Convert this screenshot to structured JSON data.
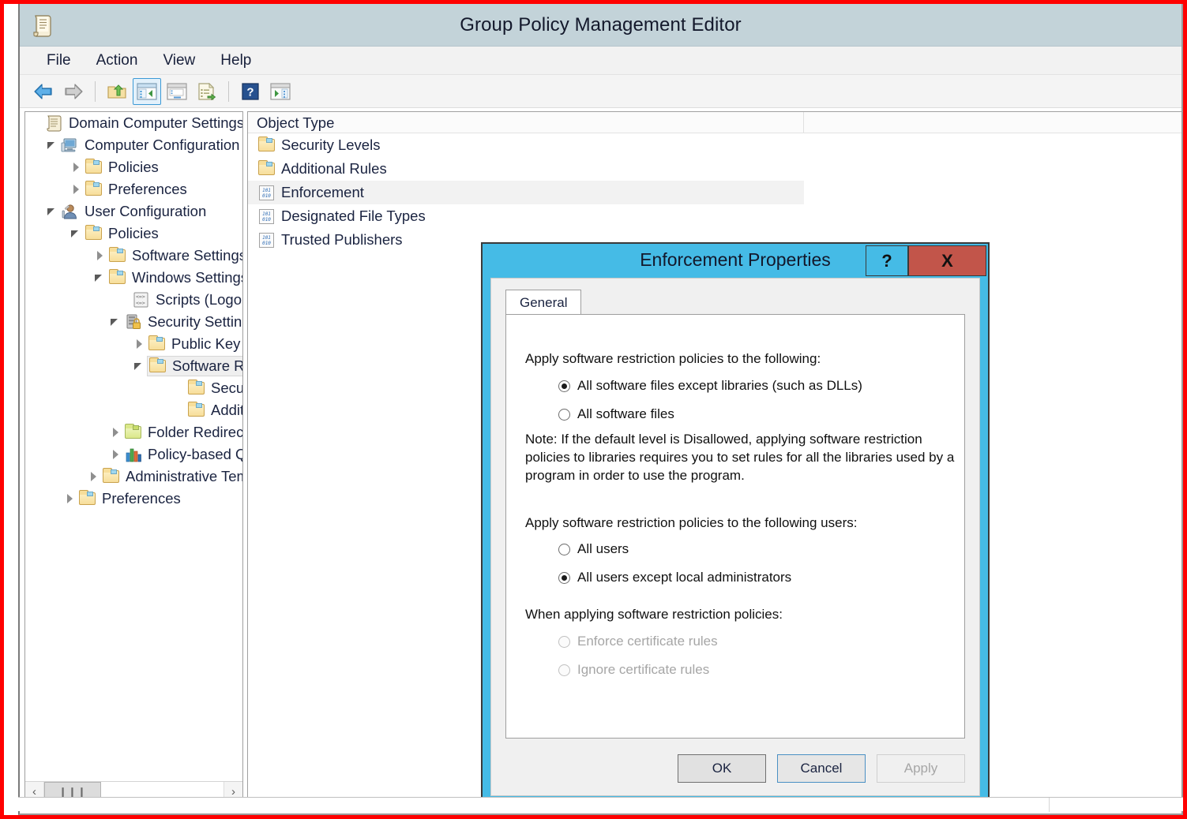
{
  "window": {
    "title": "Group Policy Management Editor",
    "icon": "scroll-document-icon"
  },
  "menubar": {
    "items": [
      {
        "label": "File"
      },
      {
        "label": "Action"
      },
      {
        "label": "View"
      },
      {
        "label": "Help"
      }
    ]
  },
  "toolbar": {
    "buttons": [
      {
        "name": "back-button",
        "icon": "left-arrow-icon"
      },
      {
        "name": "forward-button",
        "icon": "right-arrow-icon"
      },
      {
        "name": "up-one-level-button",
        "icon": "folder-up-arrow-icon"
      },
      {
        "name": "show-hide-console-tree-button",
        "icon": "console-tree-icon",
        "active": true
      },
      {
        "name": "properties-button",
        "icon": "properties-window-icon"
      },
      {
        "name": "export-list-button",
        "icon": "export-list-icon"
      },
      {
        "name": "help-button",
        "icon": "question-mark-icon"
      },
      {
        "name": "show-action-pane-button",
        "icon": "action-pane-icon"
      }
    ]
  },
  "tree": {
    "root_label": "Domain Computer Settings",
    "items": [
      {
        "label": "Domain Computer Settings",
        "indent": 0,
        "toggle": "none",
        "icon": "scroll-document-icon"
      },
      {
        "label": "Computer Configuration",
        "indent": 1,
        "toggle": "expanded",
        "icon": "computer-icon"
      },
      {
        "label": "Policies",
        "indent": 2,
        "toggle": "collapsed",
        "icon": "folder-icon"
      },
      {
        "label": "Preferences",
        "indent": 2,
        "toggle": "collapsed",
        "icon": "folder-icon"
      },
      {
        "label": "User Configuration",
        "indent": 1,
        "toggle": "expanded",
        "icon": "user-icon"
      },
      {
        "label": "Policies",
        "indent": 2,
        "toggle": "expanded",
        "icon": "folder-icon"
      },
      {
        "label": "Software Settings",
        "indent": 3,
        "toggle": "collapsed",
        "icon": "folder-icon"
      },
      {
        "label": "Windows Settings",
        "indent": 3,
        "toggle": "expanded",
        "icon": "folder-icon"
      },
      {
        "label": "Scripts (Logon/Logoff)",
        "indent": 4,
        "toggle": "none",
        "icon": "script-icon"
      },
      {
        "label": "Security Settings",
        "indent": 4,
        "toggle": "expanded",
        "icon": "security-settings-icon"
      },
      {
        "label": "Public Key Policies",
        "indent": 5,
        "toggle": "collapsed",
        "icon": "folder-icon"
      },
      {
        "label": "Software Restriction Policies",
        "indent": 5,
        "toggle": "expanded",
        "icon": "folder-icon",
        "selected": true
      },
      {
        "label": "Security Levels",
        "indent": 6,
        "toggle": "none",
        "icon": "folder-icon"
      },
      {
        "label": "Additional Rules",
        "indent": 6,
        "toggle": "none",
        "icon": "folder-icon"
      },
      {
        "label": "Folder Redirection",
        "indent": 4,
        "toggle": "collapsed",
        "icon": "folder-green-icon"
      },
      {
        "label": "Policy-based QoS",
        "indent": 4,
        "toggle": "collapsed",
        "icon": "bar-chart-icon"
      },
      {
        "label": "Administrative Templates",
        "indent": 3,
        "toggle": "collapsed",
        "icon": "folder-icon"
      },
      {
        "label": "Preferences",
        "indent": 2,
        "toggle": "collapsed",
        "icon": "folder-icon"
      }
    ],
    "hscrollbar": {
      "left_arrow": "‹",
      "right_arrow": "›",
      "grip": "❙❙❙"
    }
  },
  "list": {
    "columns": [
      {
        "label": "Object Type"
      }
    ],
    "rows": [
      {
        "label": "Security Levels",
        "icon": "folder-icon"
      },
      {
        "label": "Additional Rules",
        "icon": "folder-icon"
      },
      {
        "label": "Enforcement",
        "icon": "binary-document-icon",
        "selected": true
      },
      {
        "label": "Designated File Types",
        "icon": "binary-document-icon"
      },
      {
        "label": "Trusted Publishers",
        "icon": "binary-document-icon"
      }
    ]
  },
  "dialog": {
    "title": "Enforcement Properties",
    "help_button_label": "?",
    "close_button_label": "X",
    "tabs": [
      {
        "label": "General",
        "active": true
      }
    ],
    "sections": [
      {
        "label": "Apply software restriction policies to the following:",
        "options": [
          {
            "label": "All software files except libraries (such as DLLs)",
            "checked": true,
            "disabled": false
          },
          {
            "label": "All software files",
            "checked": false,
            "disabled": false
          }
        ]
      },
      {
        "label": "Apply software restriction policies to the following users:",
        "options": [
          {
            "label": "All users",
            "checked": false,
            "disabled": false
          },
          {
            "label": "All users except local administrators",
            "checked": true,
            "disabled": false
          }
        ]
      },
      {
        "label": "When applying software restriction policies:",
        "options": [
          {
            "label": "Enforce certificate rules",
            "checked": false,
            "disabled": true
          },
          {
            "label": "Ignore certificate rules",
            "checked": false,
            "disabled": true
          }
        ]
      }
    ],
    "note": "Note:  If the default level is Disallowed, applying software restriction policies to libraries requires you to set rules for all the libraries used by a program in order to use the program.",
    "buttons": [
      {
        "label": "OK",
        "state": "default"
      },
      {
        "label": "Cancel",
        "state": "focus"
      },
      {
        "label": "Apply",
        "state": "disabled"
      }
    ]
  },
  "colors": {
    "dialog_accent": "#45bbe6",
    "close_button": "#c2554a",
    "titlebar": "#c3d3d9",
    "annotation_border": "#ff0000"
  }
}
